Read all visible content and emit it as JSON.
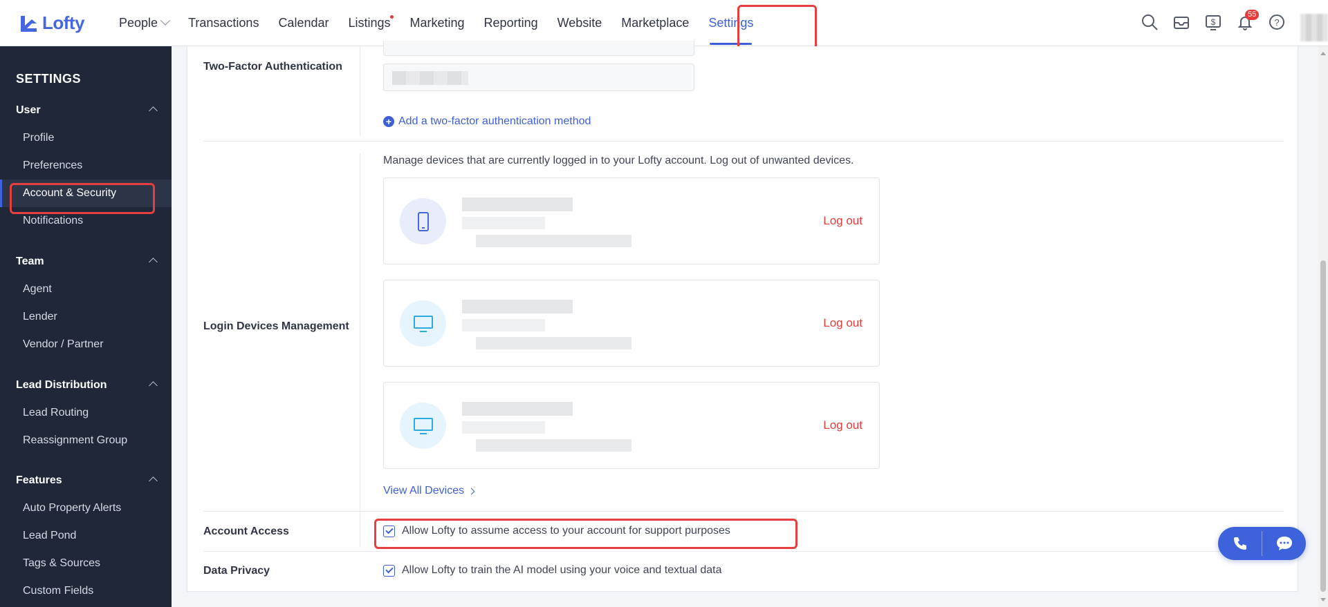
{
  "brand": {
    "name": "Lofty",
    "color": "#4467e0"
  },
  "nav": {
    "items": [
      {
        "label": "People"
      },
      {
        "label": "Transactions"
      },
      {
        "label": "Calendar"
      },
      {
        "label": "Listings"
      },
      {
        "label": "Marketing"
      },
      {
        "label": "Reporting"
      },
      {
        "label": "Website"
      },
      {
        "label": "Marketplace"
      },
      {
        "label": "Settings"
      }
    ],
    "active": "Settings",
    "notification_count": "55"
  },
  "sidebar": {
    "title": "SETTINGS",
    "groups": [
      {
        "label": "User",
        "items": [
          "Profile",
          "Preferences",
          "Account & Security",
          "Notifications"
        ]
      },
      {
        "label": "Team",
        "items": [
          "Agent",
          "Lender",
          "Vendor / Partner"
        ]
      },
      {
        "label": "Lead Distribution",
        "items": [
          "Lead Routing",
          "Reassignment Group"
        ]
      },
      {
        "label": "Features",
        "items": [
          "Auto Property Alerts",
          "Lead Pond",
          "Tags & Sources",
          "Custom Fields"
        ]
      }
    ],
    "active_item": "Account & Security"
  },
  "content": {
    "two_factor": {
      "label": "Two-Factor Authentication",
      "add_method_link": "Add a two-factor authentication method"
    },
    "login_devices": {
      "label": "Login Devices Management",
      "description": "Manage devices that are currently logged in to your Lofty account. Log out of unwanted devices.",
      "devices": [
        {
          "icon": "phone-icon",
          "action": "Log out"
        },
        {
          "icon": "monitor-icon",
          "action": "Log out"
        },
        {
          "icon": "monitor-icon",
          "action": "Log out"
        }
      ],
      "view_all": "View All Devices"
    },
    "account_access": {
      "label": "Account Access",
      "checkbox_label": "Allow Lofty to assume access to your account for support purposes",
      "checked": true
    },
    "data_privacy": {
      "label": "Data Privacy",
      "checkbox_label": "Allow Lofty to train the AI model using your voice and textual data",
      "checked": true
    }
  },
  "colors": {
    "accent": "#3f5fd6",
    "danger": "#e53b3b",
    "sidebar_bg": "#1f2738",
    "highlight": "#e53e3e"
  }
}
